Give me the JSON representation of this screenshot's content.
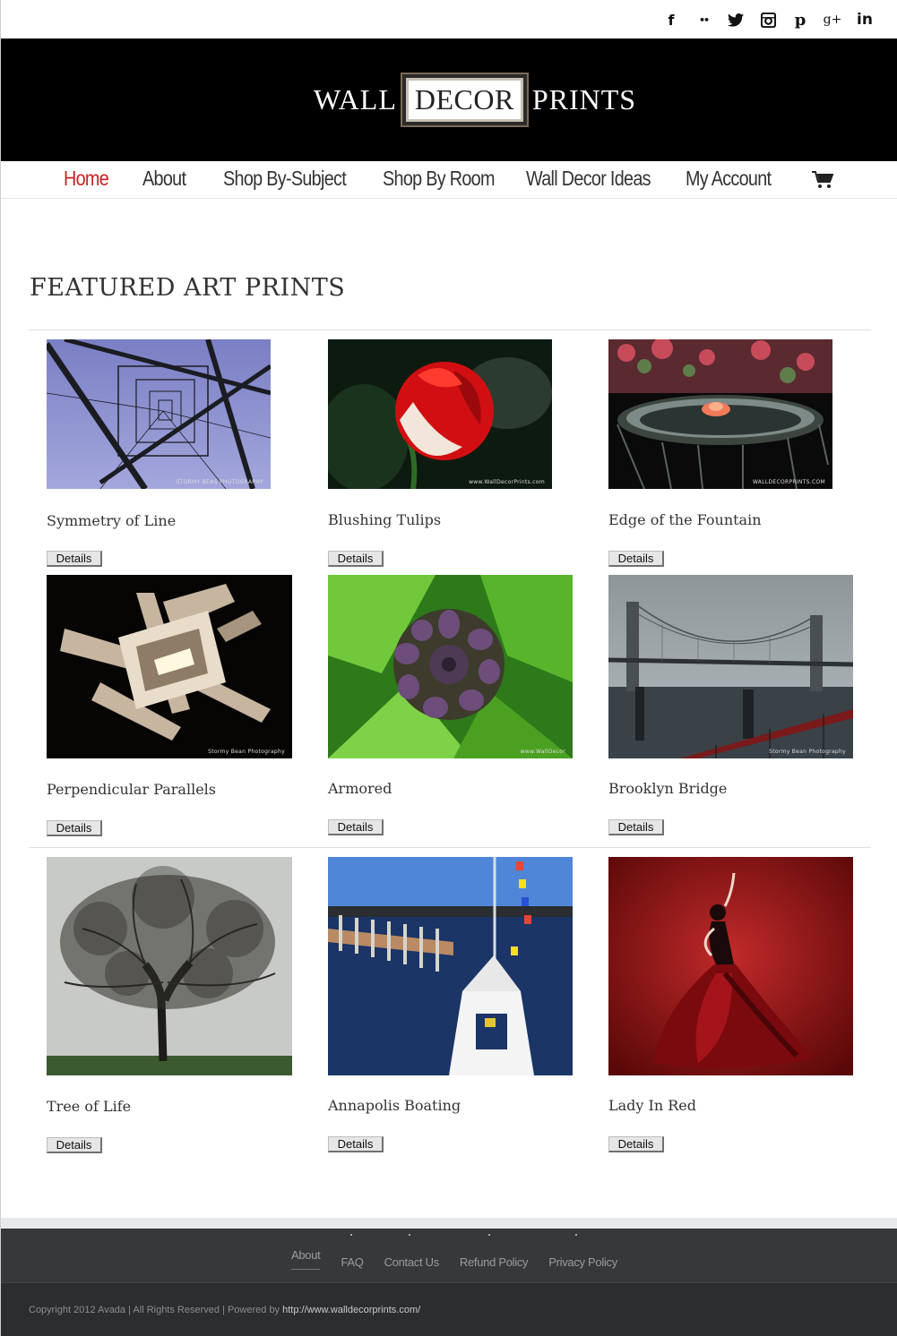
{
  "social": {
    "icons": [
      "facebook-icon",
      "flickr-icon",
      "twitter-icon",
      "instagram-icon",
      "pinterest-icon",
      "google-plus-icon",
      "linkedin-icon"
    ],
    "glyphs": [
      "f",
      "••",
      "t",
      "◙",
      "p",
      "g+",
      "in"
    ]
  },
  "logo": {
    "left": "WALL",
    "middle": "DECOR",
    "right": "PRINTS"
  },
  "nav": {
    "items": [
      "Home",
      "About",
      "Shop By-Subject",
      "Shop By Room",
      "Wall Decor Ideas",
      "My Account"
    ],
    "active": "Home",
    "active_color": "#cc1f1f"
  },
  "main": {
    "heading": "FEATURED ART PRINTS",
    "products": [
      {
        "title": "Symmetry of Line",
        "button": "Details",
        "watermark": "STORMY BEAS PHOTOGRAPHY"
      },
      {
        "title": "Blushing Tulips",
        "button": "Details",
        "watermark": "www.WallDecorPrints.com"
      },
      {
        "title": "Edge of the Fountain",
        "button": "Details",
        "watermark": "WALLDECORPRINTS.COM"
      },
      {
        "title": "Perpendicular Parallels",
        "button": "Details",
        "watermark": "Stormy Bean Photography"
      },
      {
        "title": "Armored",
        "button": "Details",
        "watermark": "www.WallDecor"
      },
      {
        "title": "Brooklyn Bridge",
        "button": "Details",
        "watermark": "Stormy Bean Photography"
      },
      {
        "title": "Tree of Life",
        "button": "Details",
        "watermark": ""
      },
      {
        "title": "Annapolis Boating",
        "button": "Details",
        "watermark": ""
      },
      {
        "title": "Lady In Red",
        "button": "Details",
        "watermark": ""
      }
    ]
  },
  "footer": {
    "links": [
      "About",
      "FAQ",
      "Contact Us",
      "Refund Policy",
      "Privacy Policy"
    ],
    "copyright_text": "Copyright 2012 Avada | All Rights Reserved | Powered by",
    "copyright_link": "http://www.walldecorprints.com/"
  }
}
